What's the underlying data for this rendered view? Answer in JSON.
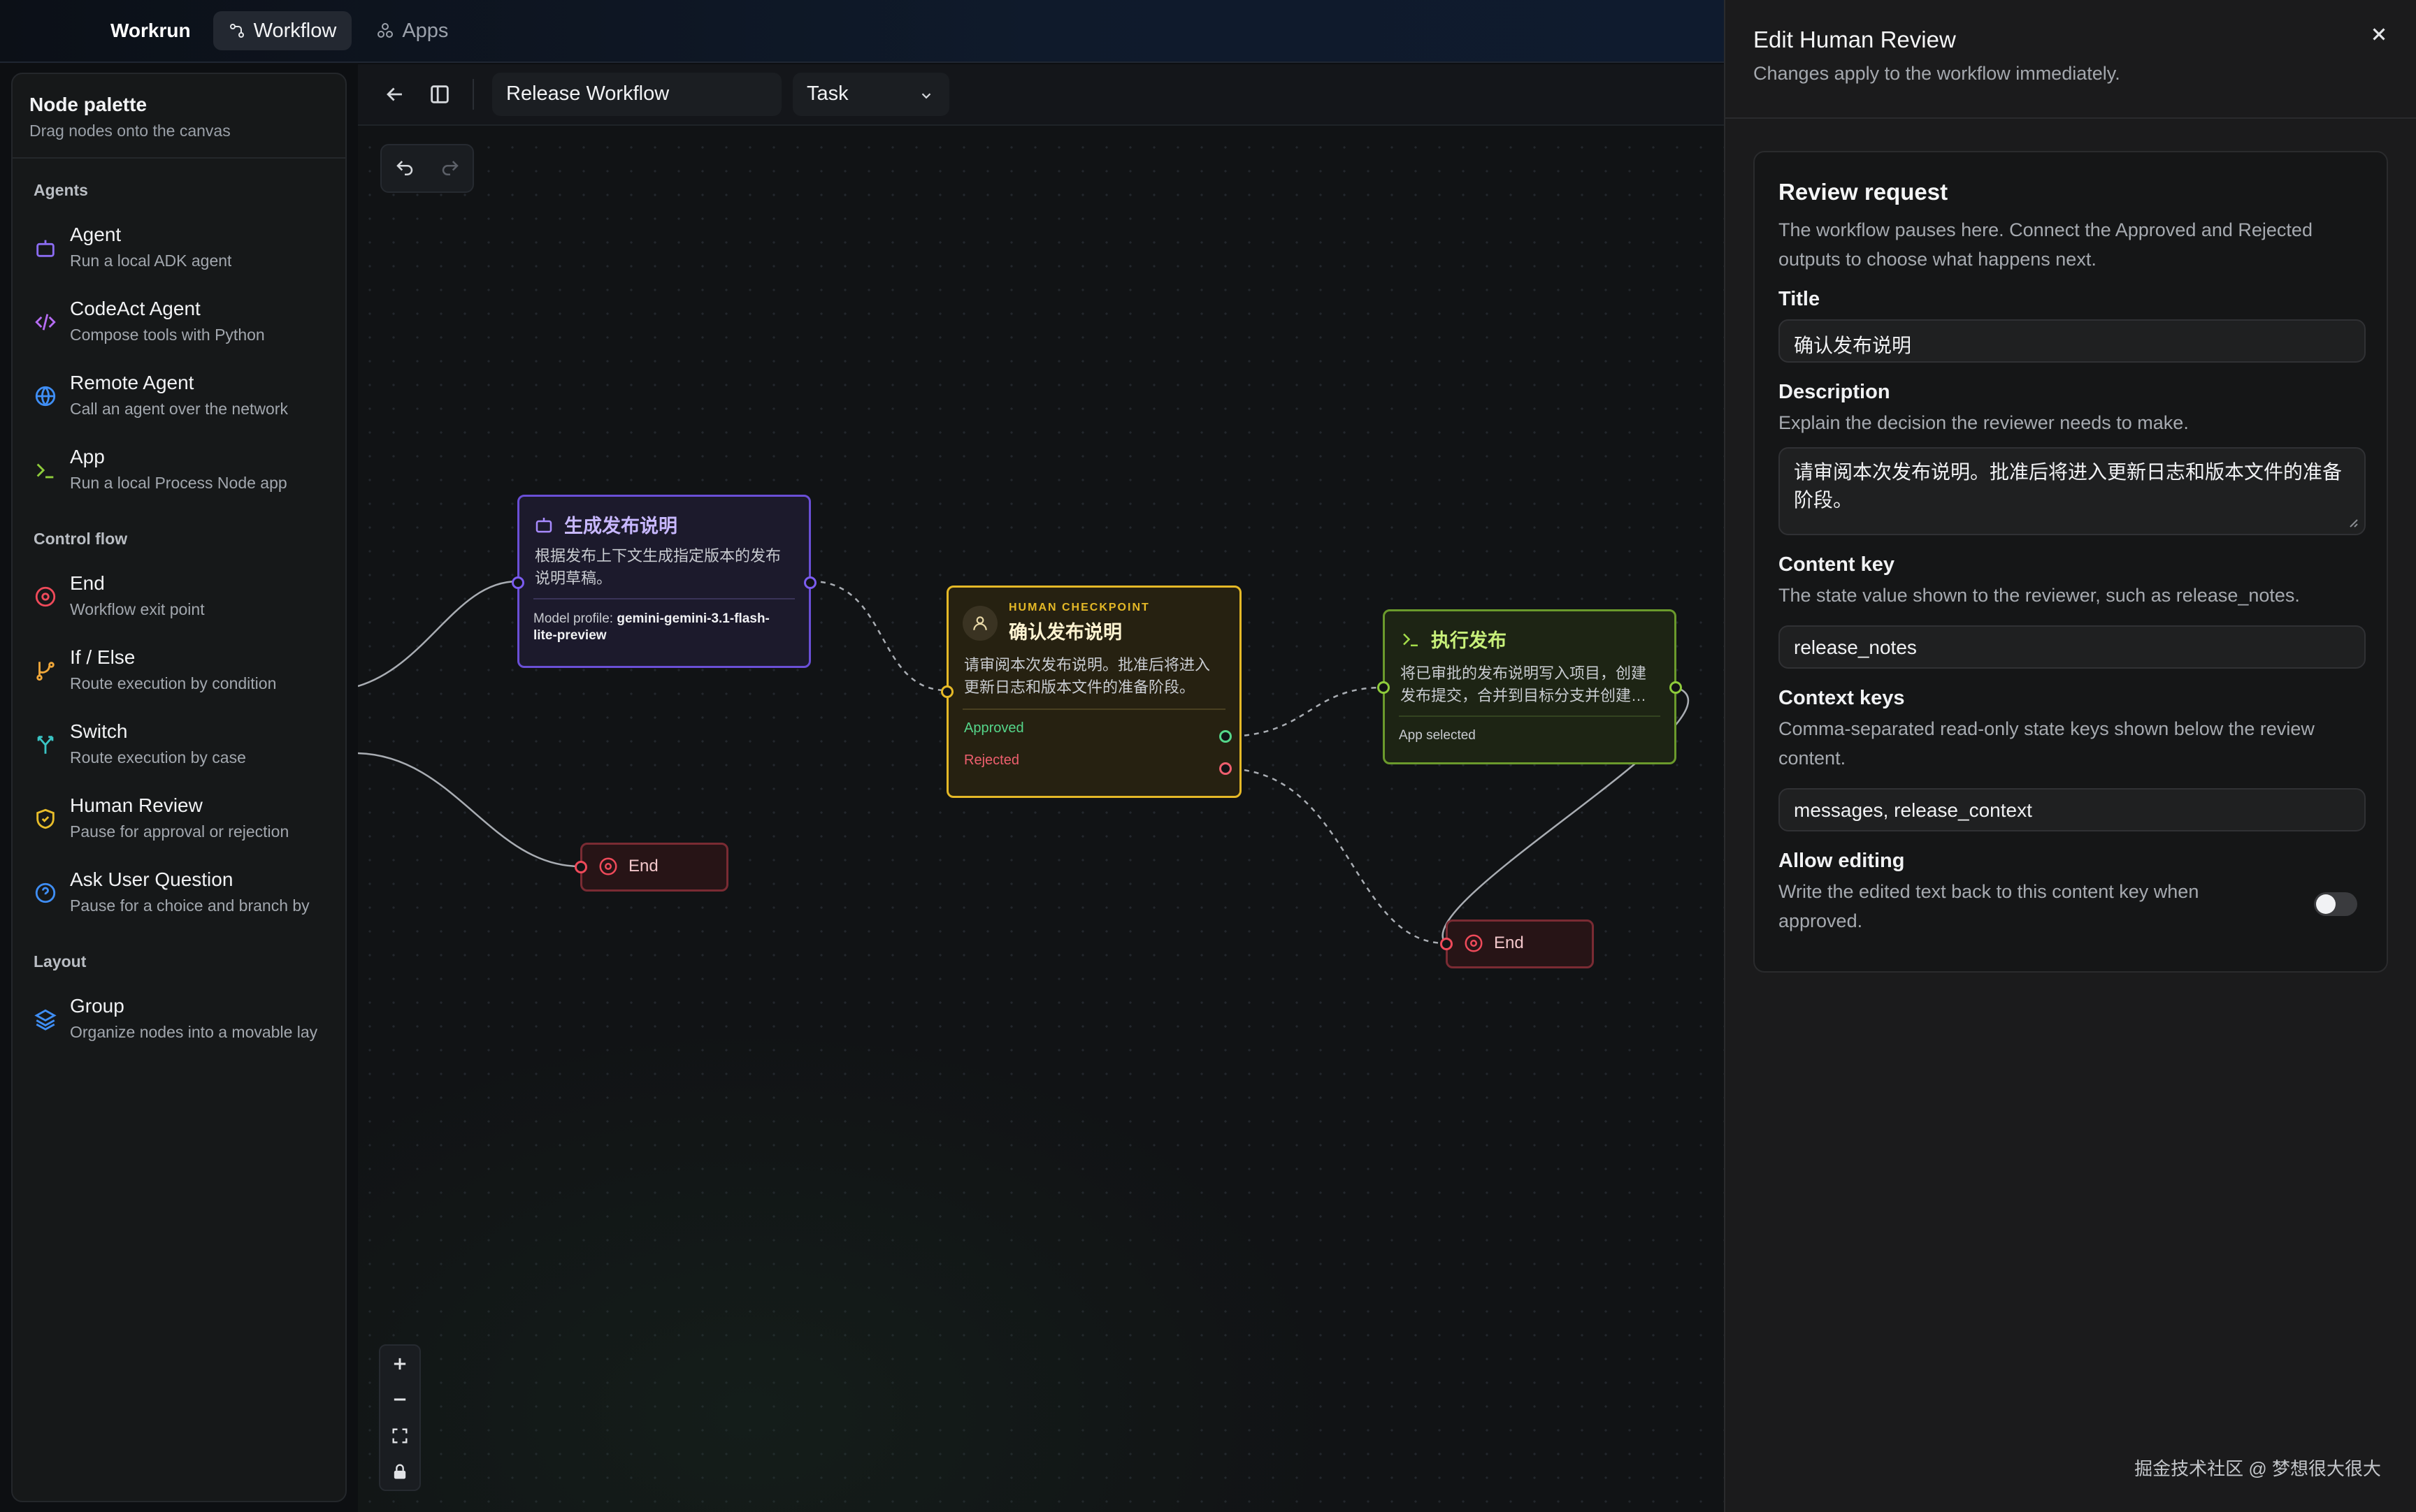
{
  "topbar": {
    "brand": "Workrun",
    "tabs": [
      {
        "label": "Workflow",
        "icon": "workflow-icon",
        "active": true
      },
      {
        "label": "Apps",
        "icon": "apps-icon",
        "active": false
      }
    ]
  },
  "palette": {
    "title": "Node palette",
    "subtitle": "Drag nodes onto the canvas",
    "sections": {
      "agents": {
        "label": "Agents",
        "items": [
          {
            "name": "Agent",
            "desc": "Run a local ADK agent",
            "icon": "robot-icon",
            "color": "#8b6cf2"
          },
          {
            "name": "CodeAct Agent",
            "desc": "Compose tools with Python",
            "icon": "code-icon",
            "color": "#b56cf2"
          },
          {
            "name": "Remote Agent",
            "desc": "Call an agent over the network",
            "icon": "globe-icon",
            "color": "#3f8ef5"
          },
          {
            "name": "App",
            "desc": "Run a local Process Node app",
            "icon": "terminal-icon",
            "color": "#8ecb3b"
          }
        ]
      },
      "control": {
        "label": "Control flow",
        "items": [
          {
            "name": "End",
            "desc": "Workflow exit point",
            "icon": "stop-circle-icon",
            "color": "#ef4a5a"
          },
          {
            "name": "If / Else",
            "desc": "Route execution by condition",
            "icon": "branch-icon",
            "color": "#f0a73a"
          },
          {
            "name": "Switch",
            "desc": "Route execution by case",
            "icon": "switch-icon",
            "color": "#3ac4c4"
          },
          {
            "name": "Human Review",
            "desc": "Pause for approval or rejection",
            "icon": "shield-icon",
            "color": "#e8bd2a"
          },
          {
            "name": "Ask User Question",
            "desc": "Pause for a choice and branch by",
            "icon": "question-icon",
            "color": "#3f8ef5"
          }
        ]
      },
      "layout": {
        "label": "Layout",
        "items": [
          {
            "name": "Group",
            "desc": "Organize nodes into a movable lay",
            "icon": "layers-icon",
            "color": "#3f8ef5"
          }
        ]
      }
    }
  },
  "toolbar": {
    "workflow_name": "Release Workflow",
    "mode": "Task"
  },
  "nodes": {
    "agent": {
      "title": "生成发布说明",
      "desc_line1": "根据发布上下文生成指定版本的发布",
      "desc_line2": "说明草稿。",
      "profile_label": "Model profile:",
      "profile_value_line1": "gemini-gemini-3.1-flash-",
      "profile_value_line2": "lite-preview"
    },
    "review": {
      "kicker": "HUMAN CHECKPOINT",
      "title": "确认发布说明",
      "desc_line1": "请审阅本次发布说明。批准后将进入",
      "desc_line2": "更新日志和版本文件的准备阶段。",
      "approved": "Approved",
      "rejected": "Rejected"
    },
    "exec": {
      "title": "执行发布",
      "desc_line1": "将已审批的发布说明写入项目，创建",
      "desc_line2": "发布提交，合并到目标分支并创建…",
      "footer": "App selected"
    },
    "end1": {
      "label": "End"
    },
    "end2": {
      "label": "End"
    }
  },
  "panel": {
    "title": "Edit Human Review",
    "subtitle": "Changes apply to the workflow immediately.",
    "card_title": "Review request",
    "intro_line1": "The workflow pauses here. Connect the Approved and Rejected",
    "intro_line2": "outputs to choose what happens next.",
    "fields": {
      "title": {
        "label": "Title",
        "value": "确认发布说明"
      },
      "description": {
        "label": "Description",
        "help": "Explain the decision the reviewer needs to make.",
        "value_line1": "请审阅本次发布说明。批准后将进入更新日志和版本文件的准备",
        "value_line2": "阶段。"
      },
      "content_key": {
        "label": "Content key",
        "help": "The state value shown to the reviewer, such as release_notes.",
        "value": "release_notes"
      },
      "context_keys": {
        "label": "Context keys",
        "help_line1": "Comma-separated read-only state keys shown below the review",
        "help_line2": "content.",
        "value": "messages, release_context"
      },
      "allow_editing": {
        "label": "Allow editing",
        "help_line1": "Write the edited text back to this content key when",
        "help_line2": "approved.",
        "enabled": false
      }
    }
  },
  "watermark": "掘金技术社区 @ 梦想很大很大"
}
